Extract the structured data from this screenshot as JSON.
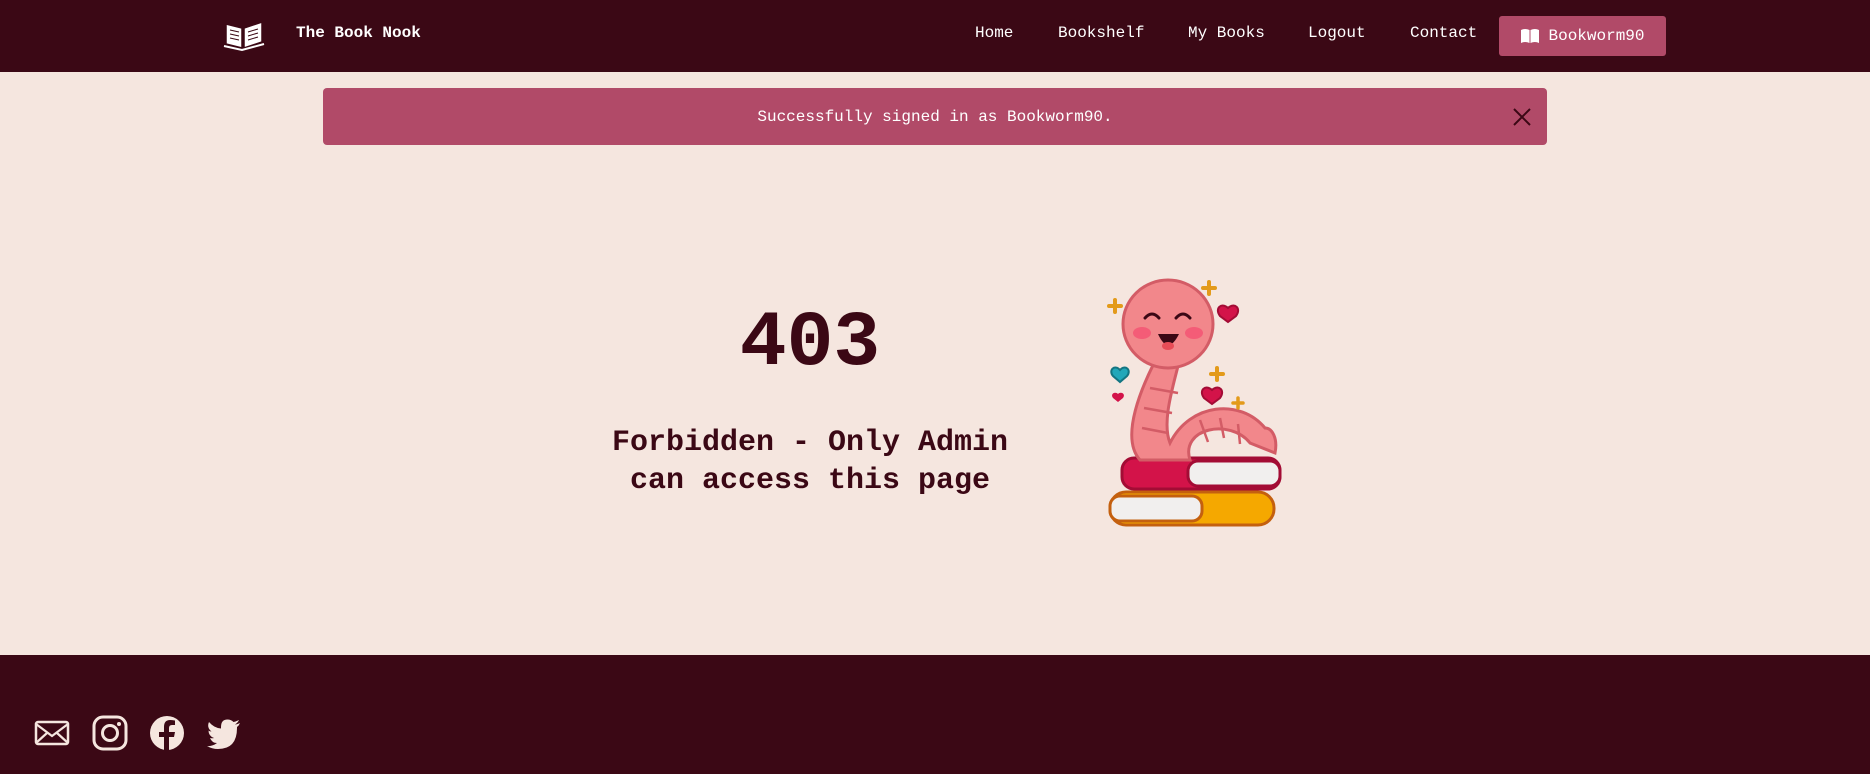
{
  "navbar": {
    "brand": "The Book Nook",
    "links": [
      "Home",
      "Bookshelf",
      "My Books",
      "Logout",
      "Contact"
    ],
    "user_label": "Bookworm90"
  },
  "alert": {
    "message": "Successfully signed in as Bookworm90."
  },
  "error": {
    "code": "403",
    "message_line1": "Forbidden - Only Admin",
    "message_line2": "can access this page"
  },
  "footer": {
    "icons": [
      "mail-icon",
      "instagram-icon",
      "facebook-icon",
      "twitter-icon"
    ]
  },
  "colors": {
    "dark": "#3b0815",
    "accent": "#b14a68",
    "background": "#f5e6df"
  }
}
